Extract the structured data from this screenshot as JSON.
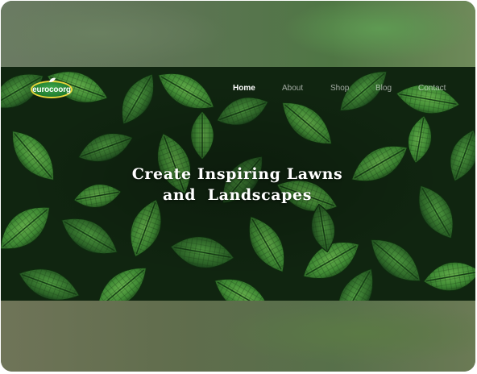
{
  "brand": {
    "logo_text": "eurocoorg",
    "logo_icon": "leaf-icon"
  },
  "nav": {
    "items": [
      {
        "label": "Home",
        "active": true
      },
      {
        "label": "About",
        "active": false
      },
      {
        "label": "Shop",
        "active": false
      },
      {
        "label": "Blog",
        "active": false
      },
      {
        "label": "Contact",
        "active": false
      }
    ]
  },
  "hero": {
    "headline_line1": "Create Inspiring Lawns",
    "headline_line2": "and  Landscapes"
  },
  "colors": {
    "leaf_dark": "#0f2a10",
    "leaf_mid": "#2f7a2c",
    "leaf_light": "#5fae4a",
    "logo_ring": "#e8d63a"
  }
}
